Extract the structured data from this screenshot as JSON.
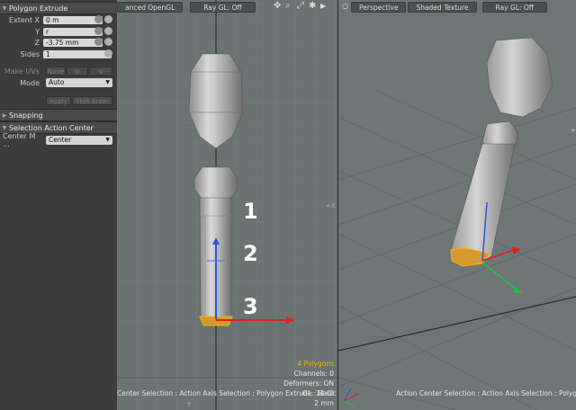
{
  "panel": {
    "section_title": "Polygon Extrude",
    "extent_x_label": "Extent X",
    "extent_x_value": "0 m",
    "y_label": "Y",
    "y_value": "r",
    "z_label": "Z",
    "z_value": "-3.75 mm",
    "sides_label": "Sides",
    "sides_value": "1",
    "make_uvs_label": "Make UVs",
    "make_uvs_none": "None",
    "make_uvs_u": "U",
    "make_uvs_v": "V",
    "mode_label": "Mode",
    "mode_value": "Auto",
    "apply_label": "Apply",
    "shift_enter_label": "Shift-Enter",
    "snapping_title": "Snapping",
    "sac_title": "Selection Action Center",
    "center_label": "Center M ...",
    "center_value": "Center"
  },
  "viewport_left": {
    "tab_opengl": "anced OpenGL",
    "tab_raygl": "Ray GL: Off",
    "polygons": "4 Polygons",
    "channels": "Channels: 0",
    "deformers": "Deformers: ON",
    "gl_status": "GL: 14 OI",
    "size": "2 mm",
    "status_text": "Center Selection : Action Axis Selection : Polygon Extrude : Basic",
    "axis_label": "+X",
    "axis_label_y": "Y",
    "annot_1": "1",
    "annot_2": "2",
    "annot_3": "3"
  },
  "viewport_right": {
    "tab_perspective": "Perspective",
    "tab_shaded": "Shaded Texture",
    "tab_raygl": "Ray GL: Off",
    "axis_label": "+",
    "status_text": "Action Center Selection : Action Axis Selection : Polygon"
  },
  "colors": {
    "accent_yellow": "#f0b400",
    "axis_red": "#e02020",
    "axis_green": "#20c040",
    "axis_blue": "#3050e0"
  }
}
